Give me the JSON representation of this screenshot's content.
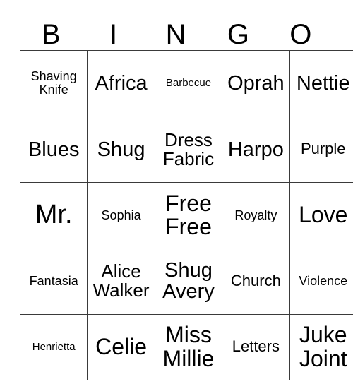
{
  "header": {
    "letters": [
      "B",
      "I",
      "N",
      "G",
      "O"
    ]
  },
  "grid": {
    "rows": [
      [
        {
          "text": "Shaving Knife",
          "size": "fs-sm"
        },
        {
          "text": "Africa",
          "size": "fs-xl"
        },
        {
          "text": "Barbecue",
          "size": "fs-xs"
        },
        {
          "text": "Oprah",
          "size": "fs-xl"
        },
        {
          "text": "Nettie",
          "size": "fs-xl"
        }
      ],
      [
        {
          "text": "Blues",
          "size": "fs-xl"
        },
        {
          "text": "Shug",
          "size": "fs-xl"
        },
        {
          "text": "Dress Fabric",
          "size": "fs-lg"
        },
        {
          "text": "Harpo",
          "size": "fs-xl"
        },
        {
          "text": "Purple",
          "size": "fs-md"
        }
      ],
      [
        {
          "text": "Mr.",
          "size": "fs-huge"
        },
        {
          "text": "Sophia",
          "size": "fs-sm"
        },
        {
          "text": "Free Free",
          "size": "fs-xxl"
        },
        {
          "text": "Royalty",
          "size": "fs-sm"
        },
        {
          "text": "Love",
          "size": "fs-xxl"
        }
      ],
      [
        {
          "text": "Fantasia",
          "size": "fs-sm"
        },
        {
          "text": "Alice Walker",
          "size": "fs-lg"
        },
        {
          "text": "Shug Avery",
          "size": "fs-xl"
        },
        {
          "text": "Church",
          "size": "fs-md"
        },
        {
          "text": "Violence",
          "size": "fs-sm"
        }
      ],
      [
        {
          "text": "Henrietta",
          "size": "fs-xs"
        },
        {
          "text": "Celie",
          "size": "fs-xxl"
        },
        {
          "text": "Miss Millie",
          "size": "fs-xxl"
        },
        {
          "text": "Letters",
          "size": "fs-md"
        },
        {
          "text": "Juke Joint",
          "size": "fs-xxl"
        }
      ]
    ]
  }
}
